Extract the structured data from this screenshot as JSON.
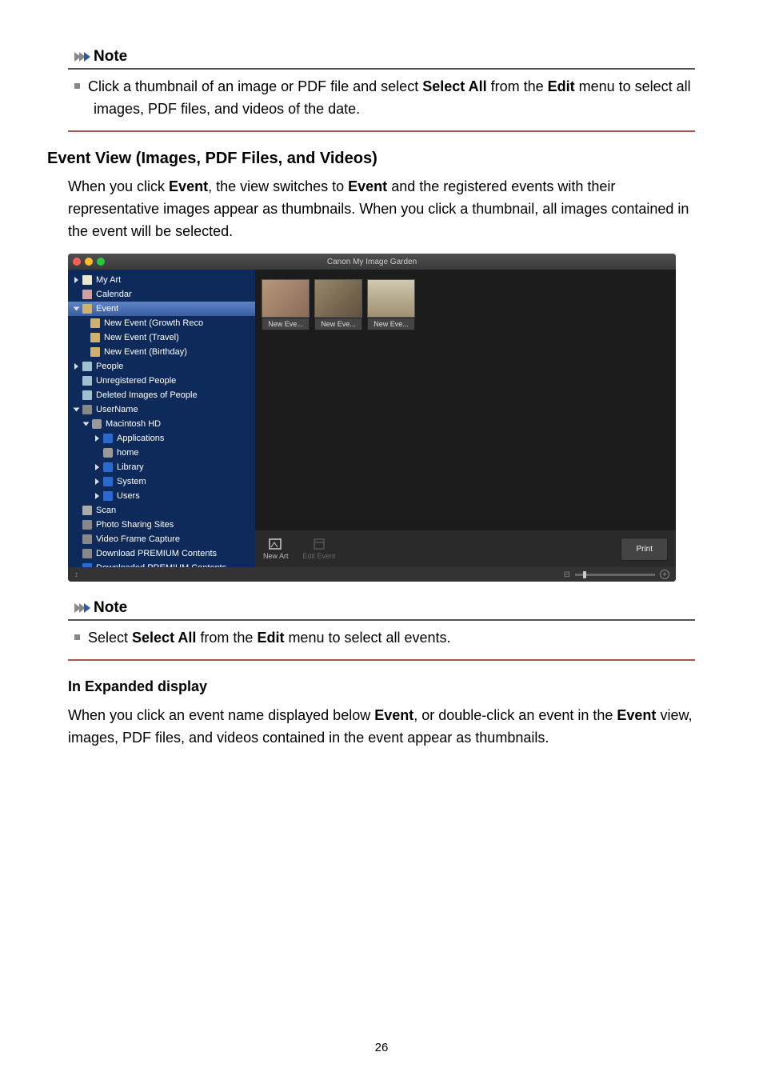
{
  "notes_label": "Note",
  "note1": {
    "pre": "Click a thumbnail of an image or PDF file and select ",
    "sel_all": "Select All",
    "mid1": " from the ",
    "edit": "Edit",
    "mid2": " menu to select all images, PDF files, and videos of the date."
  },
  "section_title": "Event View (Images, PDF Files, and Videos)",
  "p1": {
    "a": "When you click ",
    "b": "Event",
    "c": ", the view switches to ",
    "d": "Event",
    "e": " and the registered events with their representative images appear as thumbnails. When you click a thumbnail, all images contained in the event will be selected."
  },
  "screenshot": {
    "window_title": "Canon My Image Garden",
    "sidebar": {
      "my_art": "My Art",
      "calendar": "Calendar",
      "event": "Event",
      "ev_growth": "New Event (Growth Reco",
      "ev_travel": "New Event (Travel)",
      "ev_birthday": "New Event (Birthday)",
      "people": "People",
      "unreg": "Unregistered People",
      "deleted": "Deleted Images of People",
      "username": "UserName",
      "mac_hd": "Macintosh HD",
      "apps": "Applications",
      "home": "home",
      "library": "Library",
      "system": "System",
      "users": "Users",
      "scan": "Scan",
      "photo_sites": "Photo Sharing Sites",
      "video": "Video Frame Capture",
      "dl_premium": "Download PREMIUM Contents",
      "dld_premium": "Downloaded PREMIUM Contents"
    },
    "thumbs": {
      "t1": "New Eve...",
      "t2": "New Eve...",
      "t3": "New Eve..."
    },
    "toolbar": {
      "new_art": "New Art",
      "edit_event": "Edit Event",
      "print": "Print"
    },
    "status_sort": "↕"
  },
  "note2": {
    "pre": "Select ",
    "sel_all": "Select All",
    "mid1": " from the ",
    "edit": "Edit",
    "post": " menu to select all events."
  },
  "subsection_title": "In Expanded display",
  "p2": {
    "a": "When you click an event name displayed below ",
    "b": "Event",
    "c": ", or double-click an event in the ",
    "d": "Event",
    "e": " view, images, PDF files, and videos contained in the event appear as thumbnails."
  },
  "page_number": "26"
}
